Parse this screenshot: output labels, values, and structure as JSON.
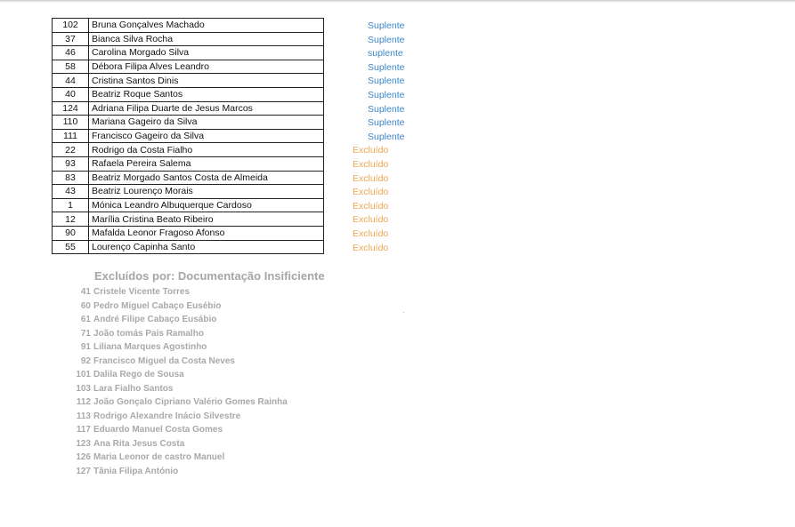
{
  "rows": [
    {
      "num": "102",
      "name": "Bruna Gonçalves Machado",
      "status": "Suplente",
      "type": "suplente"
    },
    {
      "num": "37",
      "name": "Bianca Silva Rocha",
      "status": "Suplente",
      "type": "suplente"
    },
    {
      "num": "46",
      "name": "Carolina Morgado Silva",
      "status": "suplente",
      "type": "suplente"
    },
    {
      "num": "58",
      "name": "Débora Filipa Alves Leandro",
      "status": "Suplente",
      "type": "suplente"
    },
    {
      "num": "44",
      "name": "Cristina Santos Dinis",
      "status": "Suplente",
      "type": "suplente"
    },
    {
      "num": "40",
      "name": "Beatriz Roque Santos",
      "status": "Suplente",
      "type": "suplente"
    },
    {
      "num": "124",
      "name": "Adriana Filipa Duarte de Jesus Marcos",
      "status": "Suplente",
      "type": "suplente"
    },
    {
      "num": "110",
      "name": "Mariana Gageiro da Silva",
      "status": "Suplente",
      "type": "suplente"
    },
    {
      "num": "111",
      "name": "Francisco Gageiro da Silva",
      "status": "Suplente",
      "type": "suplente"
    },
    {
      "num": "22",
      "name": "Rodrigo da Costa Fialho",
      "status": "Excluído",
      "type": "excluido"
    },
    {
      "num": "93",
      "name": "Rafaela Pereira Salema",
      "status": "Excluído",
      "type": "excluido"
    },
    {
      "num": "83",
      "name": "Beatriz Morgado Santos Costa de Almeida",
      "status": "Excluído",
      "type": "excluido"
    },
    {
      "num": "43",
      "name": "Beatriz Lourenço Morais",
      "status": "Excluído",
      "type": "excluido"
    },
    {
      "num": "1",
      "name": "Mónica Leandro Albuquerque Cardoso",
      "status": "Excluído",
      "type": "excluido"
    },
    {
      "num": "12",
      "name": "Marília Cristina Beato Ribeiro",
      "status": "Excluído",
      "type": "excluido"
    },
    {
      "num": "90",
      "name": "Mafalda Leonor Fragoso Afonso",
      "status": "Excluído",
      "type": "excluido"
    },
    {
      "num": "55",
      "name": "Lourenço Capinha Santo",
      "status": "Excluído",
      "type": "excluido"
    }
  ],
  "excluded_section": {
    "title": "Excluídos por: Documentação Insificiente",
    "items": [
      {
        "num": "41",
        "name": "Cristele Vicente Torres"
      },
      {
        "num": "60",
        "name": "Pedro Miguel Cabaço Eusébio"
      },
      {
        "num": "61",
        "name": "André Filipe Cabaço Eusábio"
      },
      {
        "num": "71",
        "name": "João tomás Pais Ramalho"
      },
      {
        "num": "91",
        "name": "Liliana Marques Agostinho"
      },
      {
        "num": "92",
        "name": "Francisco Miguel da Costa Neves"
      },
      {
        "num": "101",
        "name": "Dalila Rego de Sousa"
      },
      {
        "num": "103",
        "name": "Lara Fialho Santos"
      },
      {
        "num": "112",
        "name": "João Gonçalo Cipriano Valério Gomes Rainha"
      },
      {
        "num": "113",
        "name": "Rodrigo Alexandre Inácio Silvestre"
      },
      {
        "num": "117",
        "name": "Eduardo Manuel Costa Gomes"
      },
      {
        "num": "123",
        "name": "Ana Rita Jesus Costa"
      },
      {
        "num": "126",
        "name": "Maria Leonor de castro Manuel"
      },
      {
        "num": "127",
        "name": "Tânia Filipa António"
      }
    ]
  },
  "colors": {
    "suplente": "#3b87c9",
    "excluido": "#f0a550",
    "section_text": "#a6a6a6"
  }
}
